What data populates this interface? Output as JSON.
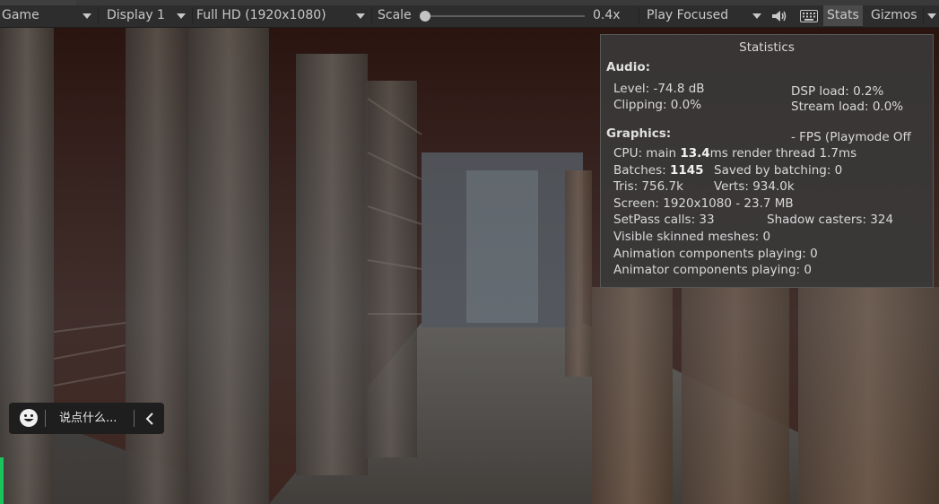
{
  "toolbar": {
    "mode": "Game",
    "display": "Display 1",
    "resolution": "Full HD (1920x1080)",
    "scale_label": "Scale",
    "scale_value": "0.4x",
    "play_mode": "Play Focused",
    "stats_label": "Stats",
    "gizmos_label": "Gizmos"
  },
  "statistics": {
    "title": "Statistics",
    "audio_header": "Audio:",
    "level": "Level: -74.8 dB",
    "dsp_load": "DSP load: 0.2%",
    "clipping": "Clipping: 0.0%",
    "stream_load": "Stream load: 0.0%",
    "graphics_header": "Graphics:",
    "fps": "- FPS (Playmode Off",
    "cpu_prefix": "CPU: main ",
    "cpu_main": "13.4",
    "cpu_suffix": "ms  render thread 1.7ms",
    "batches_prefix": "Batches: ",
    "batches": "1145",
    "saved_by_batching": "Saved by batching: 0",
    "tris": "Tris: 756.7k",
    "verts": "Verts: 934.0k",
    "screen": "Screen: 1920x1080 - 23.7 MB",
    "setpass": "SetPass calls: 33",
    "shadow_casters": "Shadow casters: 324",
    "skinned_meshes": "Visible skinned meshes: 0",
    "animation_components": "Animation components playing: 0",
    "animator_components": "Animator components playing: 0"
  },
  "chat": {
    "placeholder": "说点什么..."
  },
  "icons": {
    "audio": "speaker-icon",
    "keyboard": "keyboard-icon",
    "emoji": "emoji-icon",
    "collapse": "chevron-left-icon"
  },
  "colors": {
    "toolbar_bg": "#2d2d2d",
    "stats_active": "#4a4a4a",
    "overlay_bg": "#3a3a3a",
    "accent_green": "#19c45a"
  }
}
